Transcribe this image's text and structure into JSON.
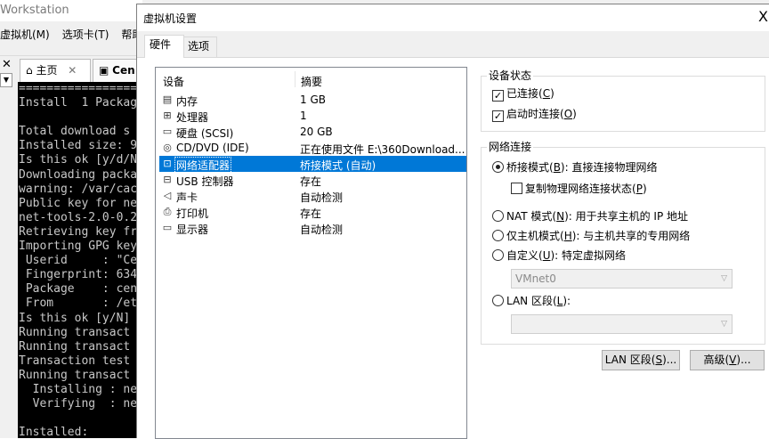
{
  "background": {
    "app_title": "Workstation",
    "menu": [
      "虚拟机(M)",
      "选项卡(T)",
      "帮助"
    ],
    "tabs": [
      {
        "label": "主页",
        "icon": "home-icon"
      },
      {
        "label": "Cen",
        "icon": "vm-icon"
      }
    ],
    "terminal_lines": [
      "=================",
      "Install  1 Package",
      "",
      "Total download s",
      "Installed size: 9",
      "Is this ok [y/d/N",
      "Downloading packa",
      "warning: /var/cac",
      "Public key for ne",
      "net-tools-2.0-0.2",
      "Retrieving key fr",
      "Importing GPG key",
      " Userid     : \"Ce",
      " Fingerprint: 634",
      " Package    : cen",
      " From       : /et",
      "Is this ok [y/N]",
      "Running transact",
      "Running transact",
      "Transaction test",
      "Running transact",
      "  Installing : ne",
      "  Verifying  : ne",
      "",
      "Installed:"
    ]
  },
  "dialog": {
    "title": "虚拟机设置",
    "close_label": "X",
    "tabs": {
      "hardware": "硬件",
      "options": "选项"
    },
    "device_list": {
      "header_device": "设备",
      "header_summary": "摘要",
      "devices": [
        {
          "name": "内存",
          "summary": "1 GB",
          "icon": "memory-icon",
          "glyph": "▤"
        },
        {
          "name": "处理器",
          "summary": "1",
          "icon": "cpu-icon",
          "glyph": "⊞"
        },
        {
          "name": "硬盘 (SCSI)",
          "summary": "20 GB",
          "icon": "hard-disk-icon",
          "glyph": "▭"
        },
        {
          "name": "CD/DVD (IDE)",
          "summary": "正在使用文件 E:\\360Download...",
          "icon": "cd-dvd-icon",
          "glyph": "◎"
        },
        {
          "name": "网络适配器",
          "summary": "桥接模式 (自动)",
          "icon": "network-adapter-icon",
          "glyph": "⊡"
        },
        {
          "name": "USB 控制器",
          "summary": "存在",
          "icon": "usb-icon",
          "glyph": "⊟"
        },
        {
          "name": "声卡",
          "summary": "自动检测",
          "icon": "sound-card-icon",
          "glyph": "◁"
        },
        {
          "name": "打印机",
          "summary": "存在",
          "icon": "printer-icon",
          "glyph": "⎙"
        },
        {
          "name": "显示器",
          "summary": "自动检测",
          "icon": "display-icon",
          "glyph": "▭"
        }
      ],
      "selected_index": 4
    },
    "device_status": {
      "title": "设备状态",
      "connected": {
        "label": "已连接(",
        "key": "C",
        "suffix": ")",
        "checked": true
      },
      "connect_at_power_on": {
        "label": "启动时连接(",
        "key": "O",
        "suffix": ")",
        "checked": true
      }
    },
    "network_connection": {
      "title": "网络连接",
      "bridged": {
        "label": "桥接模式(",
        "key": "B",
        "suffix": "): 直接连接物理网络",
        "selected": true
      },
      "replicate": {
        "label": "复制物理网络连接状态(",
        "key": "P",
        "suffix": ")",
        "checked": false
      },
      "nat": {
        "label": "NAT 模式(",
        "key": "N",
        "suffix": "): 用于共享主机的 IP 地址",
        "selected": false
      },
      "host_only": {
        "label": "仅主机模式(",
        "key": "H",
        "suffix": "): 与主机共享的专用网络",
        "selected": false
      },
      "custom": {
        "label": "自定义(",
        "key": "U",
        "suffix": "): 特定虚拟网络",
        "selected": false
      },
      "custom_value": "VMnet0",
      "lan_segment": {
        "label": "LAN 区段(",
        "key": "L",
        "suffix": "):",
        "selected": false
      },
      "lan_value": ""
    },
    "buttons": {
      "lan_segments": {
        "label": "LAN 区段(",
        "key": "S",
        "suffix": ")..."
      },
      "advanced": {
        "label": "高级(",
        "key": "V",
        "suffix": ")..."
      }
    }
  }
}
